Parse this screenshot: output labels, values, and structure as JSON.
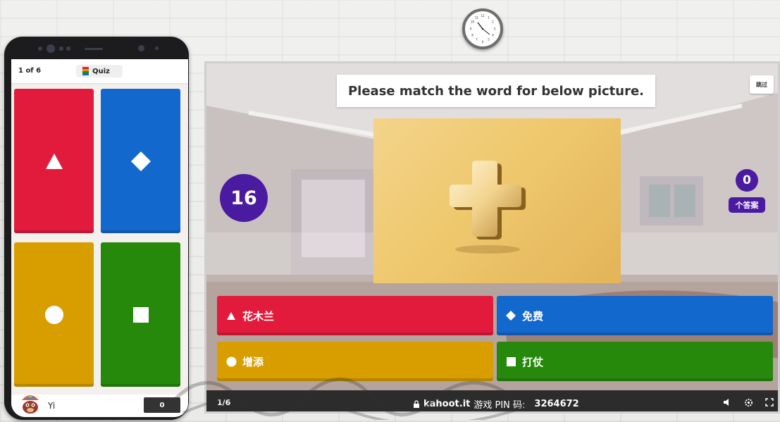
{
  "phone": {
    "question_count": "1 of 6",
    "mode_label": "Quiz",
    "tiles": [
      {
        "shape": "triangle-icon",
        "color": "#e21b3c"
      },
      {
        "shape": "diamond-icon",
        "color": "#1368ce"
      },
      {
        "shape": "circle-icon",
        "color": "#d89e00"
      },
      {
        "shape": "square-icon",
        "color": "#26890c"
      }
    ],
    "player_name": "Yi",
    "score": "0"
  },
  "board": {
    "question": "Please match the word for below picture.",
    "skip_label": "跳过",
    "timer": "16",
    "answers_count": "0",
    "answers_label": "个答案",
    "answers": [
      {
        "label": "花木兰",
        "shape": "triangle-icon",
        "color": "#e21b3c"
      },
      {
        "label": "免费",
        "shape": "diamond-icon",
        "color": "#1368ce"
      },
      {
        "label": "增添",
        "shape": "circle-icon",
        "color": "#d89e00"
      },
      {
        "label": "打仗",
        "shape": "square-icon",
        "color": "#26890c"
      }
    ],
    "bottom": {
      "progress": "1/6",
      "brand": "kahoot.it",
      "pin_label": "游戏 PIN 码:",
      "pin": "3264672"
    }
  }
}
